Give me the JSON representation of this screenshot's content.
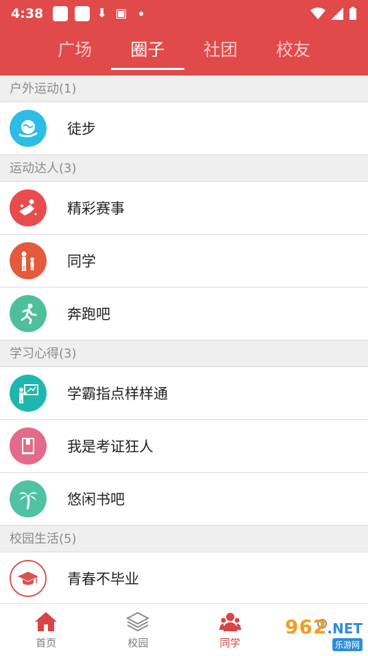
{
  "status_bar": {
    "time": "4:38"
  },
  "tabs": [
    {
      "label": "广场"
    },
    {
      "label": "圈子",
      "active": true
    },
    {
      "label": "社团"
    },
    {
      "label": "校友"
    }
  ],
  "sections": [
    {
      "header": "户外运动(1)",
      "items": [
        {
          "label": "徒步",
          "icon": "globe-hand-icon",
          "color": "#2ebce6"
        }
      ]
    },
    {
      "header": "运动达人(3)",
      "items": [
        {
          "label": "精彩赛事",
          "icon": "sport-figure-icon",
          "color": "#e84c4c"
        },
        {
          "label": "同学",
          "icon": "parent-child-icon",
          "color": "#e35a3c"
        },
        {
          "label": "奔跑吧",
          "icon": "runner-icon",
          "color": "#4fbf9a"
        }
      ]
    },
    {
      "header": "学习心得(3)",
      "items": [
        {
          "label": "学霸指点样样通",
          "icon": "teacher-board-icon",
          "color": "#1db7b0"
        },
        {
          "label": "我是考证狂人",
          "icon": "book-icon",
          "color": "#e36a8a"
        },
        {
          "label": "悠闲书吧",
          "icon": "palm-tree-icon",
          "color": "#4fc2a5"
        }
      ]
    },
    {
      "header": "校园生活(5)",
      "items": [
        {
          "label": "青春不毕业",
          "icon": "graduation-cap-icon",
          "color": "#d9534f"
        }
      ]
    }
  ],
  "bottom_nav": [
    {
      "label": "首页",
      "icon": "home-icon"
    },
    {
      "label": "校园",
      "icon": "layers-icon"
    },
    {
      "label": "同学",
      "icon": "people-icon",
      "active": true
    },
    {
      "label": "",
      "icon": "profile-icon"
    }
  ],
  "watermark": {
    "number": "962",
    "net": ".NET",
    "text": "乐游网"
  },
  "colors": {
    "brand": "#e04a4a",
    "section_bg": "#efefef",
    "active_nav": "#d94444"
  }
}
